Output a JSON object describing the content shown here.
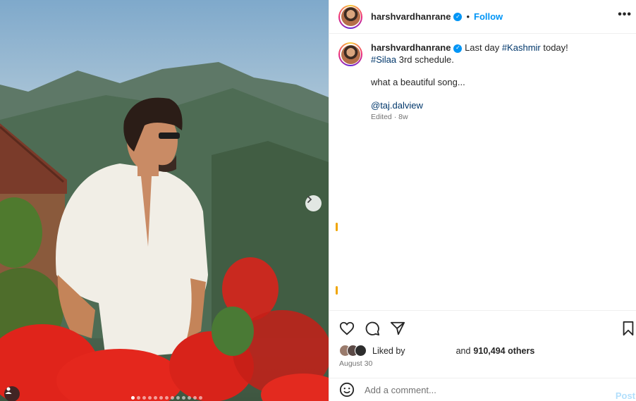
{
  "post": {
    "username": "harshvardhanrane",
    "follow_label": "Follow",
    "separator": "•",
    "more_icon": "more-horizontal-icon",
    "caption": {
      "username": "harshvardhanrane",
      "line1_text": "Last day ",
      "line1_tag": "#Kashmir",
      "line1_end": " today!",
      "line2_tag": "#Silaa",
      "line2_text": " 3rd schedule.",
      "line3": "what a beautiful song...",
      "mention": "@taj.dalview",
      "edited": "Edited · 8w"
    },
    "likes": {
      "prefix": "Liked by",
      "suffix": "and",
      "count": "910,494 others"
    },
    "date": "August 30",
    "comment": {
      "placeholder": "Add a comment...",
      "post_label": "Post"
    },
    "carousel": {
      "slides": 13,
      "active_index": 0
    }
  },
  "colors": {
    "link": "#0095f6",
    "hashtag": "#00376b",
    "post_disabled": "#b2dffc"
  }
}
